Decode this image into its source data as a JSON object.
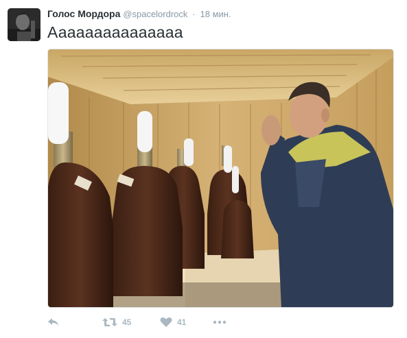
{
  "tweet": {
    "author_name": "Голос Мордора",
    "handle": "@spacelordrock",
    "separator": "·",
    "time": "18 мин.",
    "text": "Ааааааааааааааа"
  },
  "actions": {
    "retweet_count": "45",
    "like_count": "41"
  },
  "icons": {
    "reply": "reply-icon",
    "retweet": "retweet-icon",
    "like": "heart-icon",
    "more": "more-icon"
  },
  "colors": {
    "name": "#292f33",
    "meta": "#8899a6",
    "action": "#aab8c2"
  }
}
